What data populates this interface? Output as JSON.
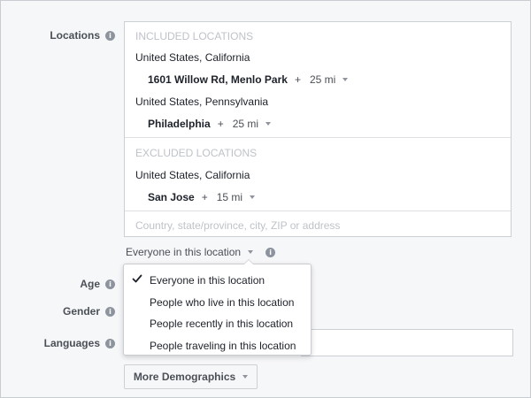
{
  "labels": {
    "locations": "Locations",
    "age": "Age",
    "gender": "Gender",
    "languages": "Languages"
  },
  "locations": {
    "included_header": "INCLUDED LOCATIONS",
    "included": [
      {
        "country": "United States, California",
        "place": "1601 Willow Rd, Menlo Park",
        "plus": "+",
        "radius": "25 mi"
      },
      {
        "country": "United States, Pennsylvania",
        "place": "Philadelphia",
        "plus": "+",
        "radius": "25 mi"
      }
    ],
    "excluded_header": "EXCLUDED LOCATIONS",
    "excluded": [
      {
        "country": "United States, California",
        "place": "San Jose",
        "plus": "+",
        "radius": "15 mi"
      }
    ],
    "input_placeholder": "Country, state/province, city, ZIP or address"
  },
  "audience_select": {
    "value": "Everyone in this location"
  },
  "dropdown": {
    "options": [
      {
        "label": "Everyone in this location",
        "selected": true
      },
      {
        "label": "People who live in this location",
        "selected": false
      },
      {
        "label": "People recently in this location",
        "selected": false
      },
      {
        "label": "People traveling in this location",
        "selected": false
      }
    ]
  },
  "more_button": {
    "label": "More Demographics"
  },
  "icons": {
    "info": "i"
  },
  "colors": {
    "background": "#f6f7f9",
    "text": "#1d2129",
    "label": "#4b4f56",
    "muted": "#bec3c9"
  }
}
